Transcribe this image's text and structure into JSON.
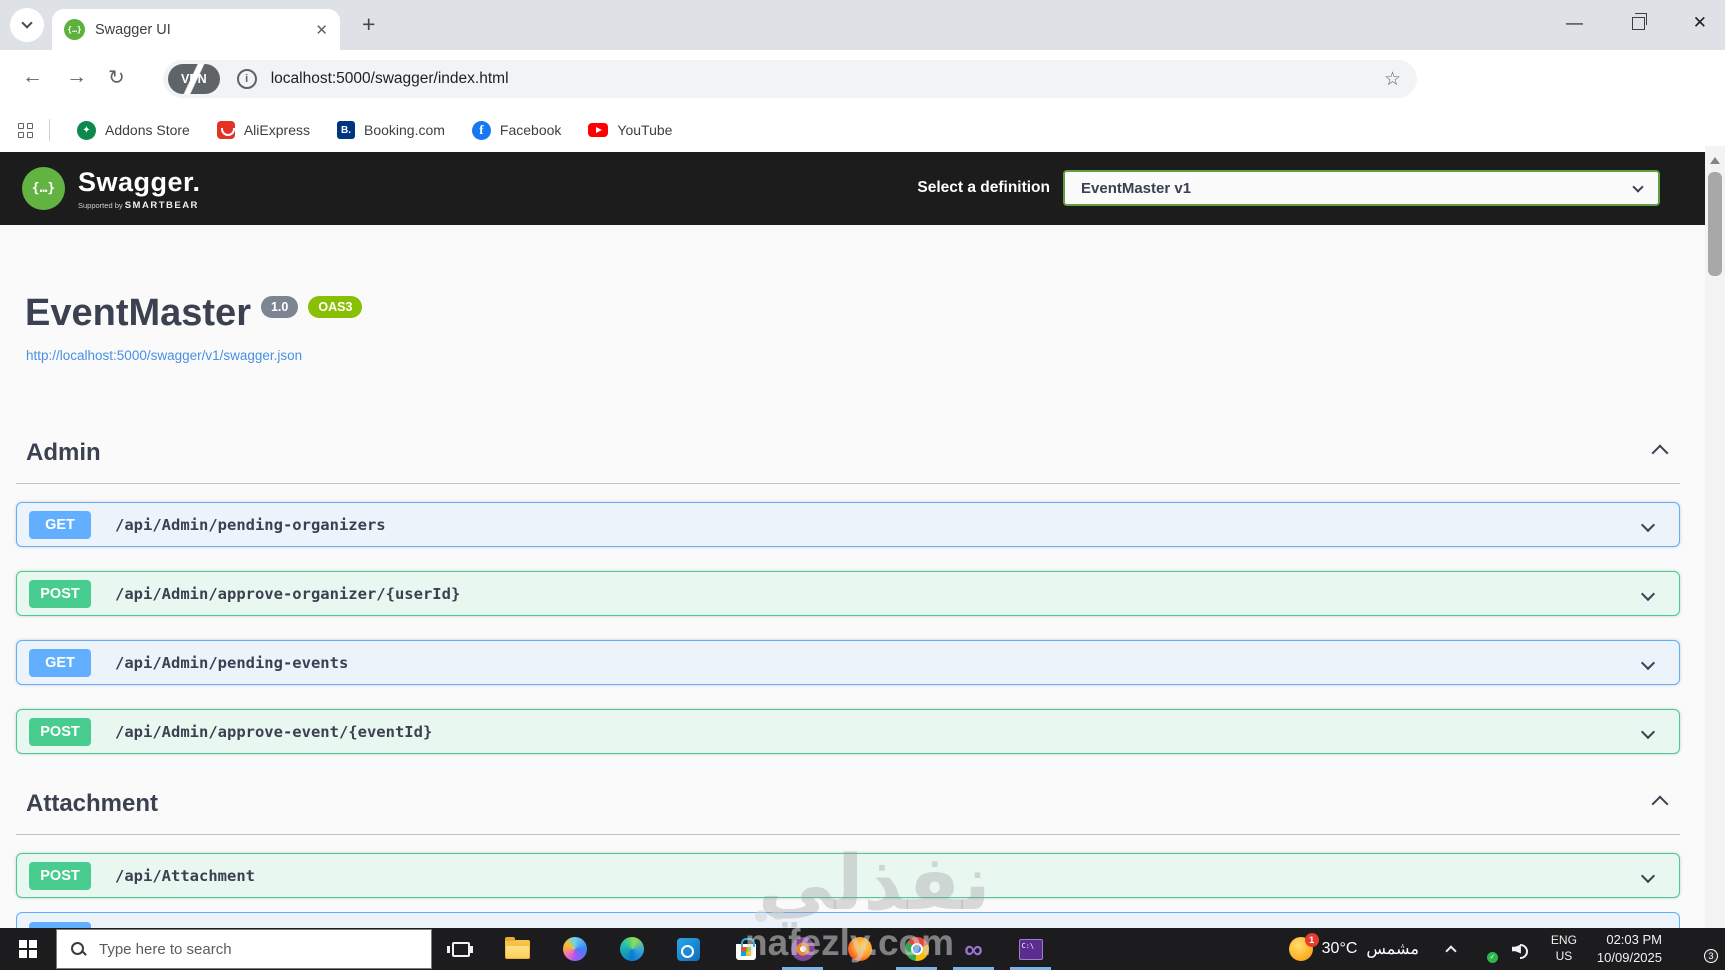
{
  "icons": {
    "close": "✕",
    "new_tab": "+",
    "back": "←",
    "forward": "→",
    "reload": "↻",
    "info": "i",
    "star": "☆",
    "menu_dots": "⋮",
    "minimize": "—",
    "bolt": "ϟ",
    "check": "✓",
    "swagger_braces": "{…}",
    "vs_infinity": "∞"
  },
  "browser": {
    "tab_title": "Swagger UI",
    "vpn_badge": "VPN",
    "url": "localhost:5000/swagger/index.html",
    "addons_glyph": "✦",
    "bookmarks": [
      {
        "label": "Addons Store"
      },
      {
        "label": "AliExpress"
      },
      {
        "label": "Booking.com",
        "glyph": "B."
      },
      {
        "label": "Facebook",
        "glyph": "f"
      },
      {
        "label": "YouTube"
      }
    ]
  },
  "swagger": {
    "logo_text": "Swagger.",
    "supported_by": "Supported by",
    "smartbear": "SMARTBEAR",
    "select_label": "Select a definition",
    "selected_definition": "EventMaster v1",
    "api_title": "EventMaster",
    "version_badge": "1.0",
    "oas_badge": "OAS3",
    "spec_url": "http://localhost:5000/swagger/v1/swagger.json",
    "colors": {
      "get": "#61affe",
      "post": "#49cc90",
      "accent_green": "#62a03f"
    },
    "sections": [
      {
        "name": "Admin",
        "endpoints": [
          {
            "method": "GET",
            "path": "/api/Admin/pending-organizers"
          },
          {
            "method": "POST",
            "path": "/api/Admin/approve-organizer/{userId}"
          },
          {
            "method": "GET",
            "path": "/api/Admin/pending-events"
          },
          {
            "method": "POST",
            "path": "/api/Admin/approve-event/{eventId}"
          }
        ]
      },
      {
        "name": "Attachment",
        "endpoints": [
          {
            "method": "POST",
            "path": "/api/Attachment"
          }
        ]
      }
    ]
  },
  "taskbar": {
    "search_placeholder": "Type here to search",
    "console_label": "C:\\",
    "weather": {
      "badge": "1",
      "temp": "30°C",
      "condition": "مشمس"
    },
    "language": {
      "primary": "ENG",
      "secondary": "US"
    },
    "clock": {
      "time": "02:03 PM",
      "date": "10/09/2025"
    },
    "notification_count": "3"
  },
  "watermark": {
    "arabic": "نفذلي",
    "latin": "nafezly.com"
  }
}
